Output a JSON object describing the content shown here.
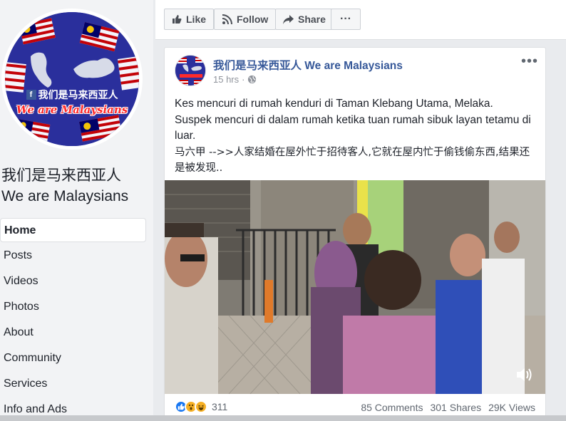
{
  "page": {
    "name_line1": "我们是马来西亚人",
    "name_line2": "We are Malaysians",
    "avatar_text_cn": "我们是马来西亚人",
    "avatar_text_en": "We are Malaysians"
  },
  "nav": {
    "items": [
      {
        "label": "Home",
        "active": true
      },
      {
        "label": "Posts"
      },
      {
        "label": "Videos"
      },
      {
        "label": "Photos"
      },
      {
        "label": "About"
      },
      {
        "label": "Community"
      },
      {
        "label": "Services"
      },
      {
        "label": "Info and Ads"
      }
    ]
  },
  "actions": {
    "like_label": "Like",
    "follow_label": "Follow",
    "share_label": "Share",
    "more_label": "···"
  },
  "post": {
    "author": "我们是马来西亚人 We are Malaysians",
    "time": "15 hrs",
    "more_label": "•••",
    "text_line1": "Kes mencuri di rumah kenduri di Taman Klebang Utama, Melaka.",
    "text_line2": "Suspek mencuri di dalam rumah ketika tuan rumah sibuk layan tetamu di luar.",
    "text_line3": "马六甲 -->>人家结婚在屋外忙于招待客人,它就在屋内忙于偷钱偷东西,结果还是被发现..",
    "reaction_count": "311",
    "comments": "85 Comments",
    "shares": "301 Shares",
    "views": "29K Views"
  },
  "colors": {
    "link_blue": "#365899",
    "brand_blue": "#2a2f9c",
    "reaction_like": "#1877f2",
    "reaction_wow": "#f7b125"
  },
  "icons": {
    "like": "thumbs-up-icon",
    "follow": "rss-icon",
    "share": "share-arrow-icon",
    "globe": "globe-icon",
    "volume": "volume-icon"
  }
}
